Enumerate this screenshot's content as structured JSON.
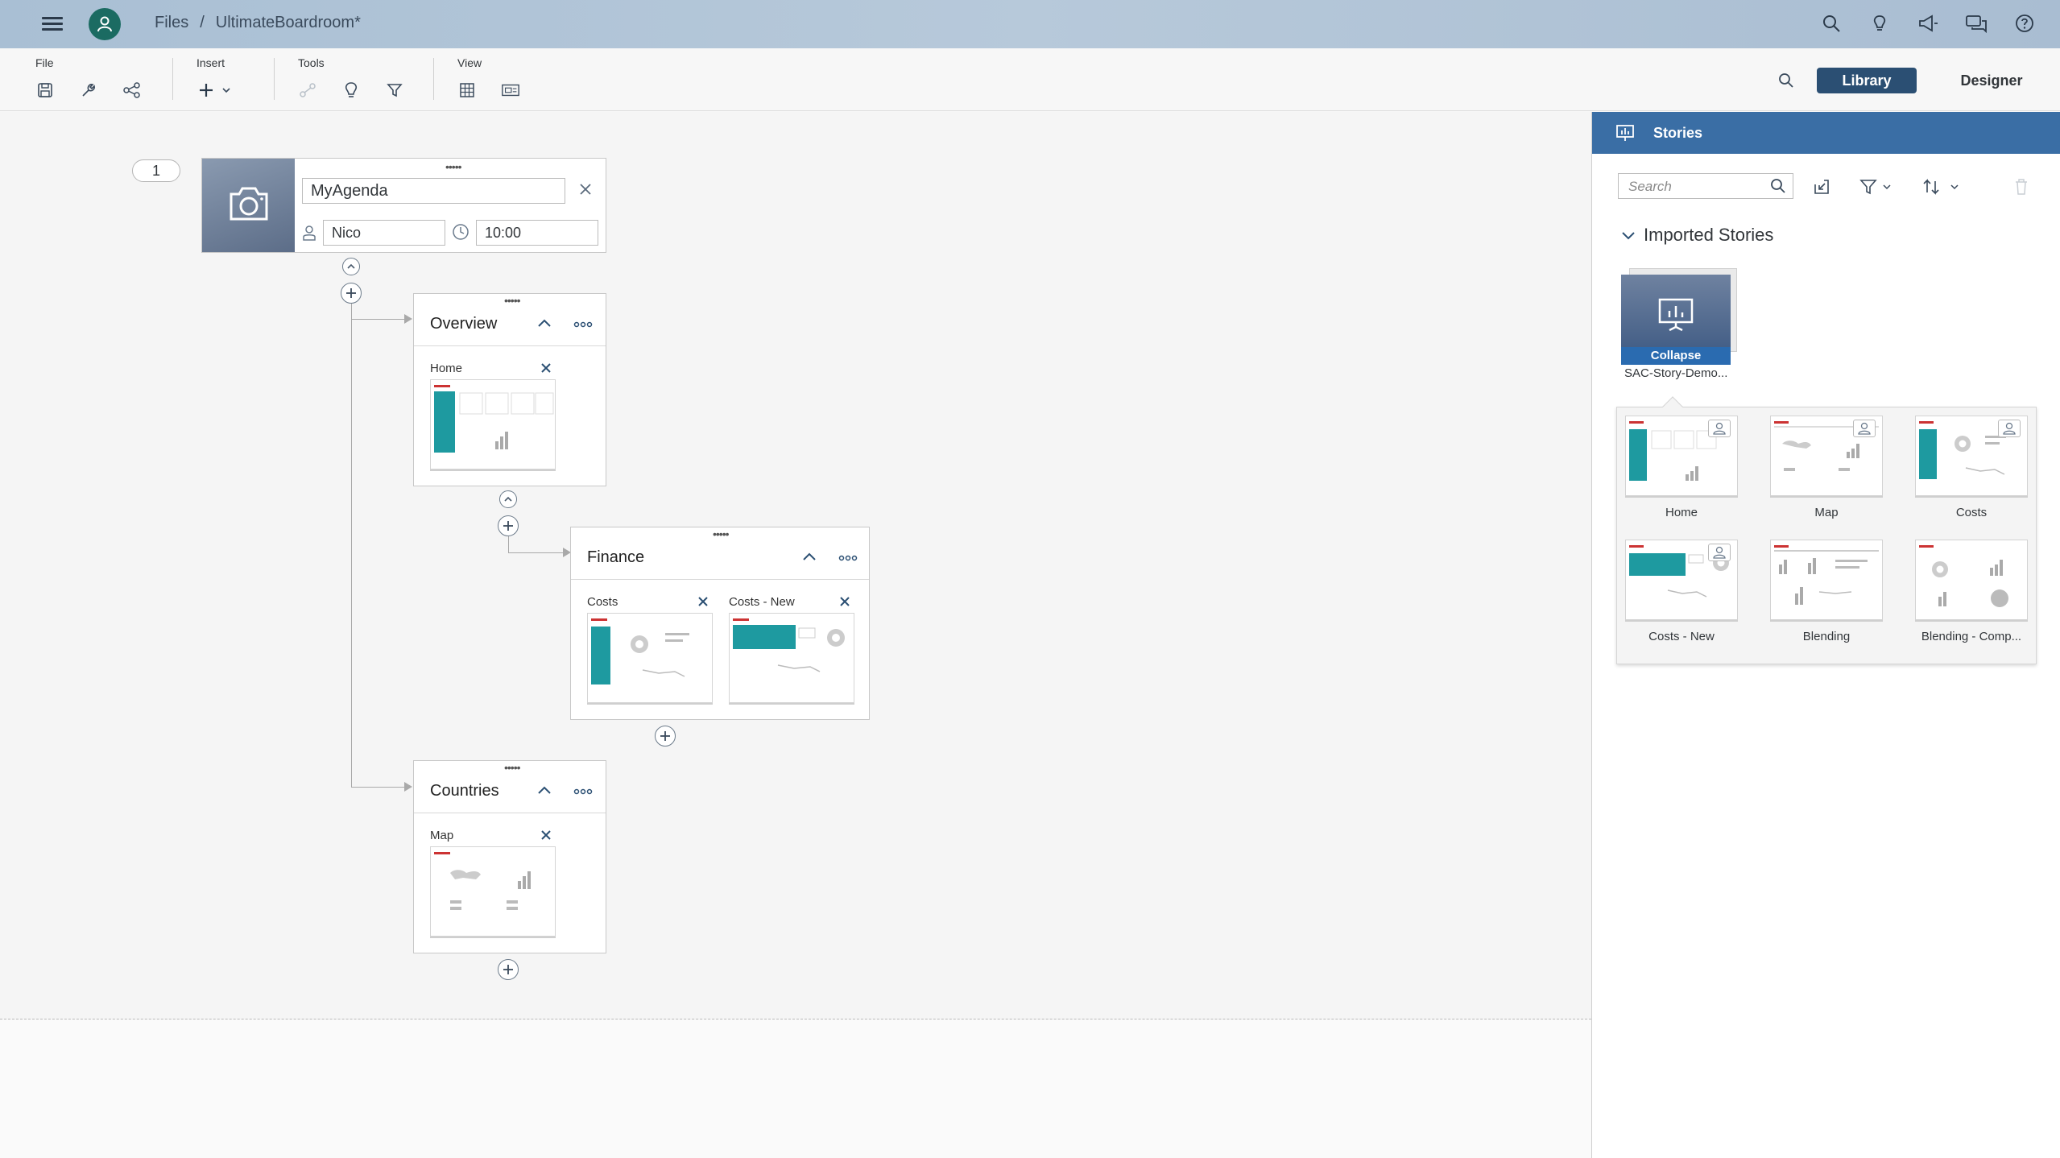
{
  "shell": {
    "breadcrumb_root": "Files",
    "breadcrumb_sep": "/",
    "breadcrumb_current": "UltimateBoardroom*",
    "icons": [
      "search-icon",
      "lightbulb-icon",
      "megaphone-icon",
      "chat-icon",
      "help-icon"
    ]
  },
  "toolbar": {
    "file_label": "File",
    "insert_label": "Insert",
    "tools_label": "Tools",
    "view_label": "View",
    "library_tab": "Library",
    "designer_tab": "Designer"
  },
  "agenda": {
    "page_number": "1",
    "title": "MyAgenda",
    "presenter": "Nico",
    "time": "10:00"
  },
  "cards": {
    "overview": {
      "title": "Overview",
      "items": [
        {
          "label": "Home"
        }
      ]
    },
    "finance": {
      "title": "Finance",
      "items": [
        {
          "label": "Costs"
        },
        {
          "label": "Costs - New"
        }
      ]
    },
    "countries": {
      "title": "Countries",
      "items": [
        {
          "label": "Map"
        }
      ]
    }
  },
  "panel": {
    "title": "Stories",
    "search_placeholder": "Search",
    "section_title": "Imported Stories",
    "folder_overlay": "Collapse",
    "folder_name": "SAC-Story-Demo...",
    "stories": [
      {
        "label": "Home"
      },
      {
        "label": "Map"
      },
      {
        "label": "Costs"
      },
      {
        "label": "Costs - New"
      },
      {
        "label": "Blending"
      },
      {
        "label": "Blending - Comp..."
      }
    ]
  },
  "colors": {
    "shell_bg": "#b1c5d9",
    "accent": "#2b4f73",
    "panel_header": "#3a6ea5",
    "teal": "#1e9aa0"
  }
}
